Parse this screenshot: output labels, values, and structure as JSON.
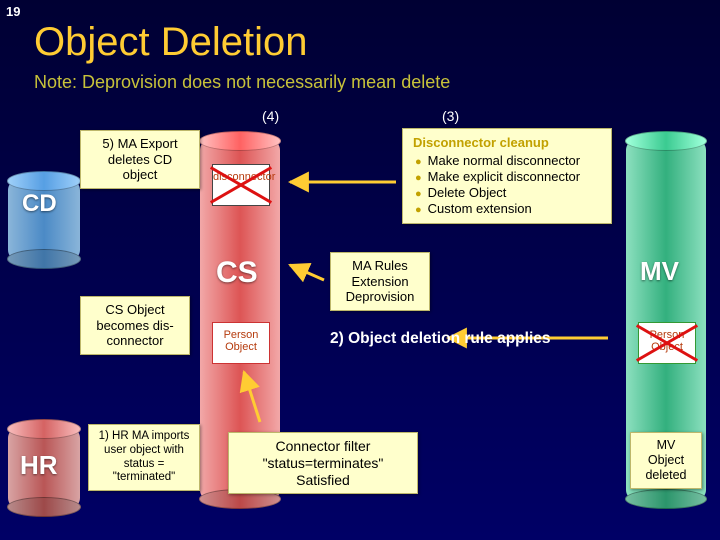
{
  "slide_number": "19",
  "title": "Object Deletion",
  "subtitle": "Note: Deprovision does not necessarily mean delete",
  "stages": {
    "four": "(4)",
    "three": "(3)"
  },
  "cylinders": {
    "cd": "CD",
    "hr": "HR",
    "cs": "CS",
    "mv": "MV"
  },
  "callouts": {
    "step5": "5) MA Export deletes CD object",
    "cs_disconnector": "CS Object becomes dis-connector",
    "step1": "1) HR MA imports user object with status = \"terminated\"",
    "ma_rules": "MA Rules Extension Deprovision",
    "connector_filter": "Connector filter \"status=terminates\" Satisfied",
    "disconnector_header": "Disconnector cleanup",
    "disconnector_items": [
      "Make normal disconnector",
      "Make explicit disconnector",
      "Delete Object",
      "Custom extension"
    ],
    "mv_deleted": "MV Object deleted"
  },
  "rule2": "2) Object deletion rule applies",
  "objects": {
    "disconnector": "disconnector",
    "person": "Person Object"
  }
}
